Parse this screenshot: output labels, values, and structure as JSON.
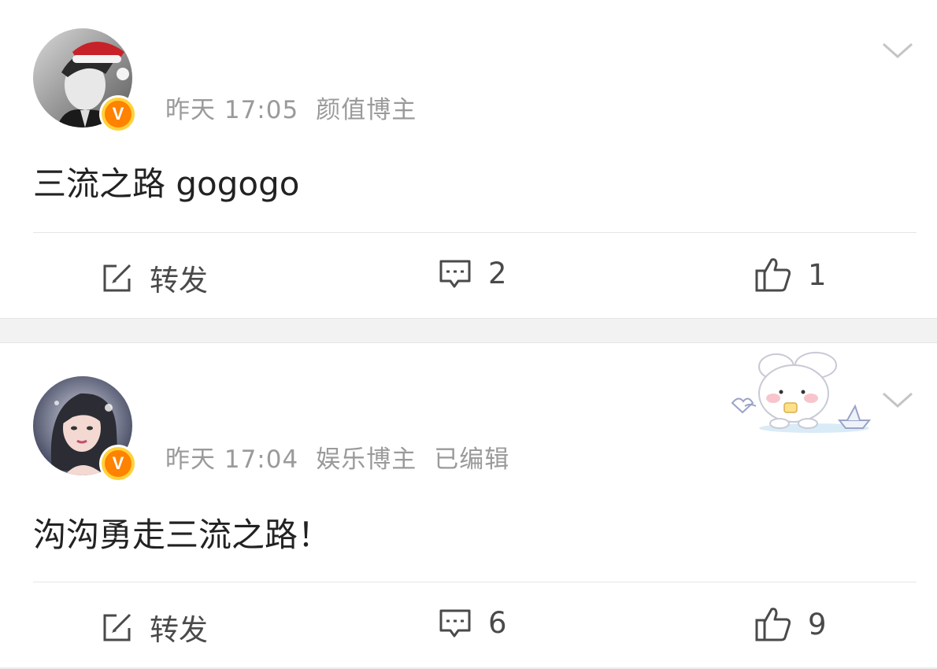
{
  "posts": [
    {
      "time": "昨天 17:05",
      "tag": "颜值博主",
      "edited": "",
      "content": "三流之路 gogogo",
      "repost_label": "转发",
      "comment_count": "2",
      "like_count": "1",
      "verified_badge": "V",
      "avatar_icon": "user-avatar-male-santa-hat"
    },
    {
      "time": "昨天 17:04",
      "tag": "娱乐博主",
      "edited": "已编辑",
      "content": "沟沟勇走三流之路！",
      "repost_label": "转发",
      "comment_count": "6",
      "like_count": "9",
      "verified_badge": "V",
      "avatar_icon": "user-avatar-female",
      "decoration": "bunny-sticker-icon"
    }
  ],
  "colors": {
    "badge_orange": "#ff8200",
    "badge_ring": "#ffd23b",
    "meta_gray": "#9a9a9a",
    "separator": "#f2f2f2"
  }
}
